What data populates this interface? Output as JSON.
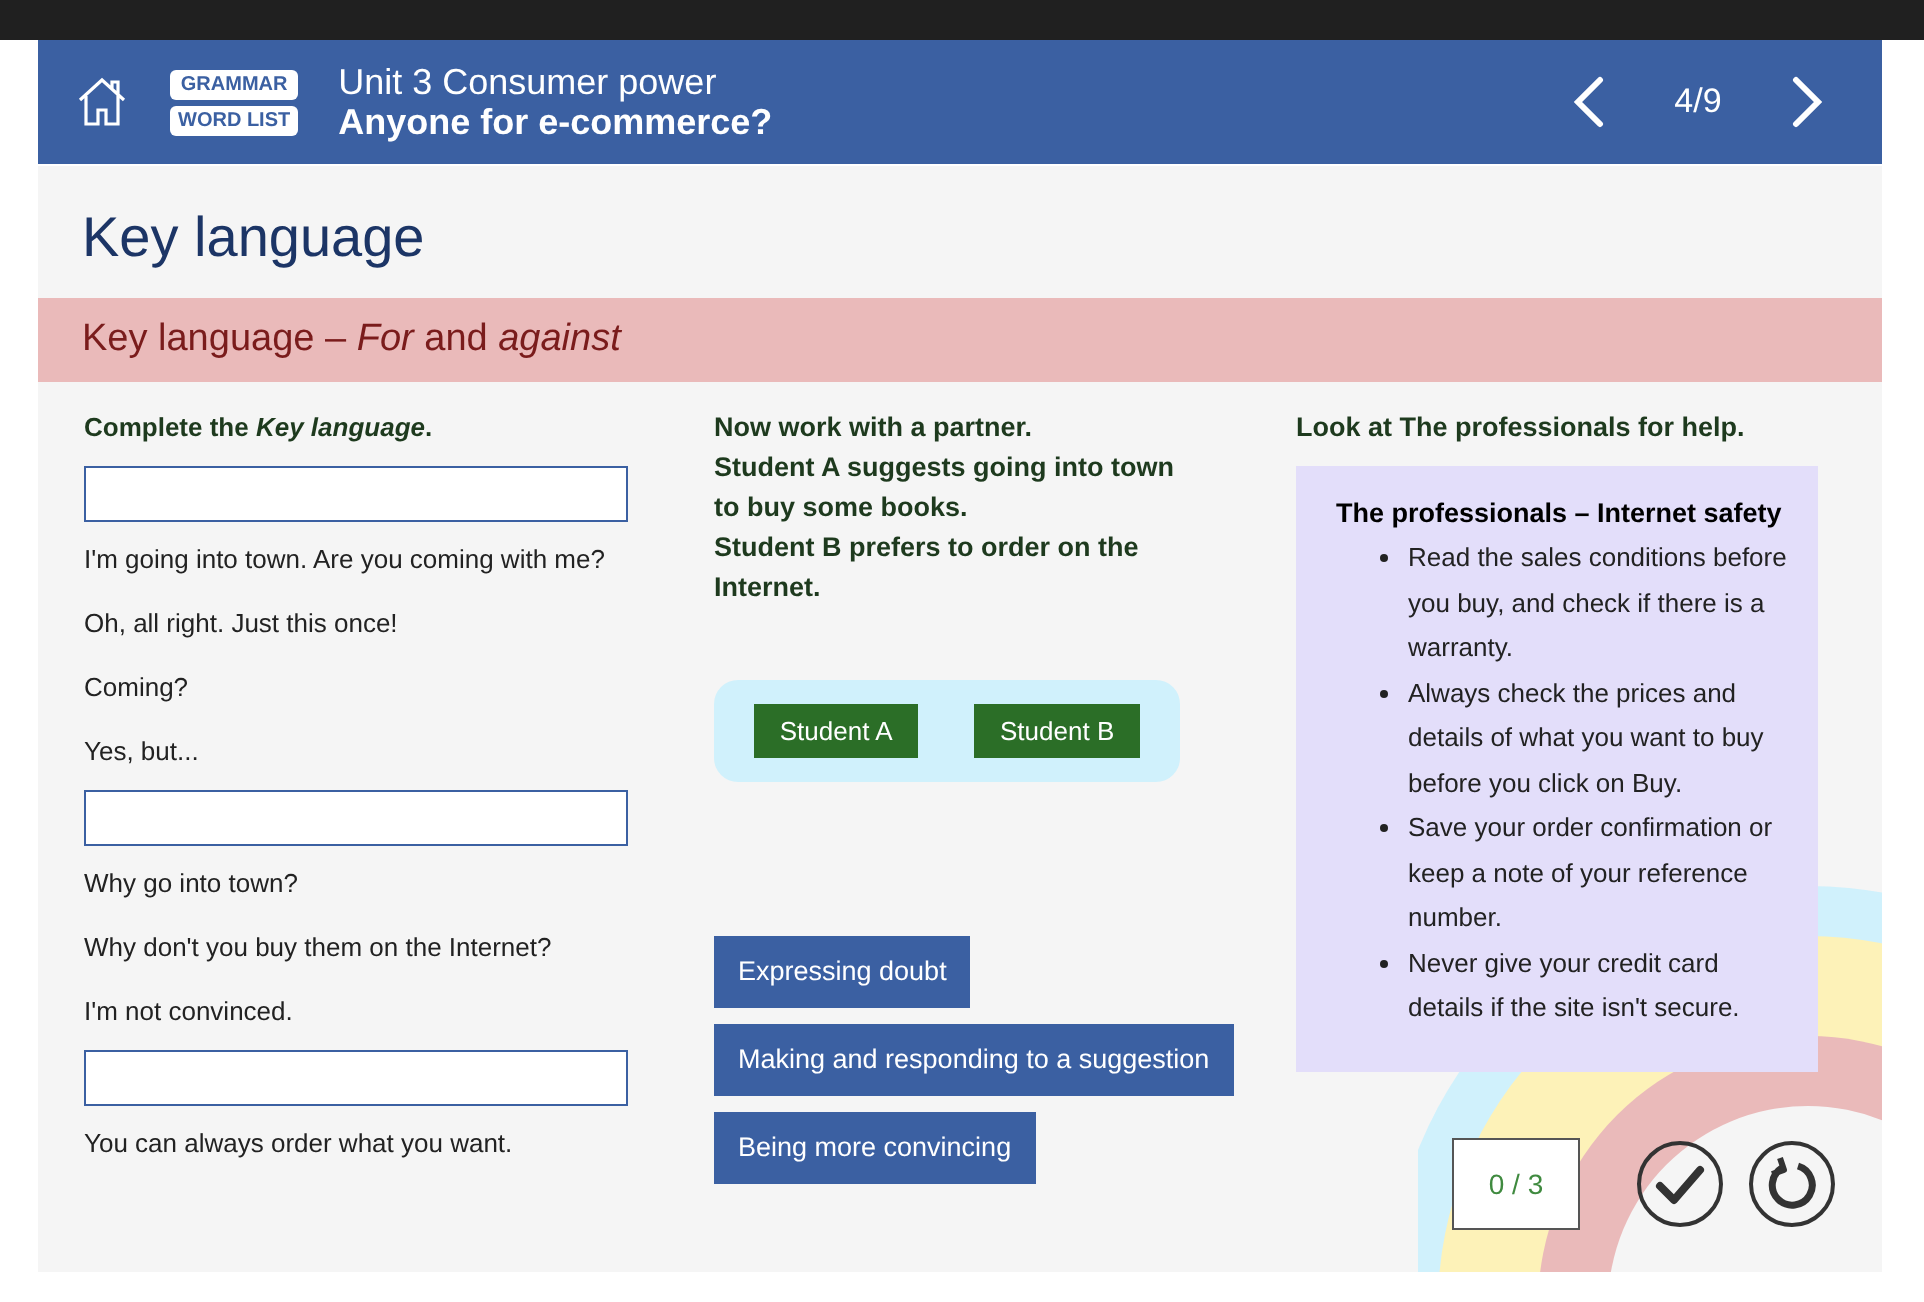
{
  "header": {
    "tags": [
      "GRAMMAR",
      "WORD LIST"
    ],
    "unit": "Unit 3 Consumer power",
    "title": "Anyone for e-commerce?",
    "page": "4/9"
  },
  "page_title": "Key language",
  "section_title": "Key language – *For* and *against*",
  "left": {
    "instruction": "Complete the *Key language*.",
    "items": [
      {
        "kind": "input"
      },
      {
        "kind": "text",
        "text": "I'm going into town. Are you coming with me?"
      },
      {
        "kind": "text",
        "text": "Oh, all right. Just this once!"
      },
      {
        "kind": "text",
        "text": "Coming?"
      },
      {
        "kind": "text",
        "text": "Yes, but..."
      },
      {
        "kind": "input"
      },
      {
        "kind": "text",
        "text": "Why go into town?"
      },
      {
        "kind": "text",
        "text": "Why don't you buy them on the Internet?"
      },
      {
        "kind": "text",
        "text": "I'm not convinced."
      },
      {
        "kind": "input"
      },
      {
        "kind": "text",
        "text": "You can always order what you want."
      }
    ]
  },
  "middle": {
    "lines": [
      "Now work with a partner.",
      "Student A suggests going into town to buy some books.",
      "Student B prefers to order on the Internet."
    ],
    "students": [
      "Student A",
      "Student B"
    ],
    "phrases": [
      "Expressing doubt",
      "Making and responding to a suggestion",
      "Being more convincing"
    ]
  },
  "right": {
    "instruction": "Look at The professionals for help.",
    "box_title": "The professionals – Internet safety",
    "bullets": [
      "Read the sales conditions before you buy, and check if there is a warranty.",
      "Always check the prices and details of what you want to buy before you click on Buy.",
      "Save your order confirmation or keep a note of your reference number.",
      "Never give your credit card details if the site isn't secure."
    ]
  },
  "score": "0 / 3"
}
